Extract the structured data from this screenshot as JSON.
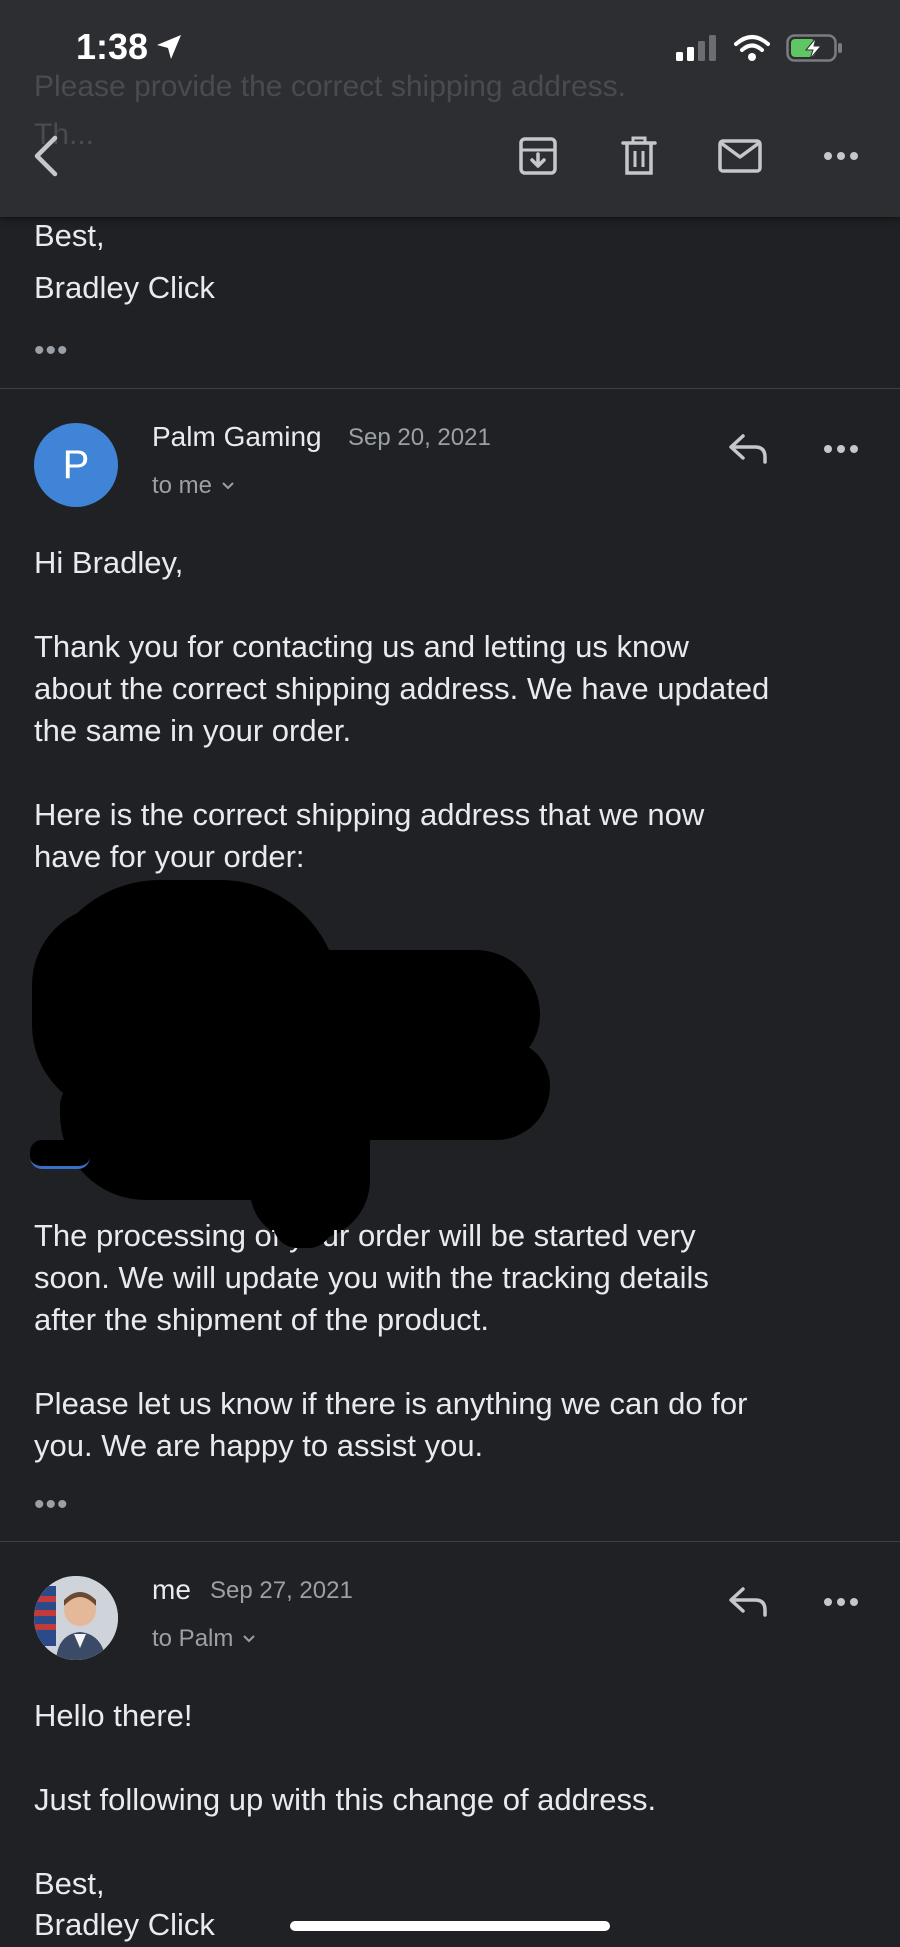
{
  "status_bar": {
    "time": "1:38"
  },
  "top_ghost": {
    "line1": "Please provide the correct shipping address.",
    "line2": "Th..."
  },
  "toolbar": {
    "back_icon": "chevron-left-icon",
    "archive_icon": "archive-icon",
    "delete_icon": "trash-icon",
    "mark_unread_icon": "mail-icon",
    "more_icon": "more-horizontal-icon"
  },
  "previous_message": {
    "signoff": "Best,",
    "signature": "Bradley Click",
    "trimmed": "•••"
  },
  "message_1": {
    "avatar_letter": "P",
    "avatar_color": "#3f84d6",
    "sender": "Palm Gaming",
    "date": "Sep 20, 2021",
    "recipient": "to me",
    "greeting": "Hi Bradley,",
    "para1": [
      "Thank you for contacting us and letting us know",
      "about the correct shipping address. We have updated",
      "the same in your order."
    ],
    "para2": [
      "Here is the correct shipping address that we now",
      "have for your order:"
    ],
    "para3": [
      "The processing of your order will be started very",
      "soon. We will update you with the tracking details",
      "after the shipment of the product."
    ],
    "para4": [
      "Please let us know if there is anything we can do for",
      "you. We are happy to assist you."
    ],
    "trimmed": "•••"
  },
  "message_2": {
    "sender": "me",
    "date": "Sep 27, 2021",
    "recipient": "to Palm",
    "greeting": "Hello there!",
    "body": "Just following up with this change of address.",
    "signoff": "Best,",
    "signature": "Bradley Click"
  }
}
